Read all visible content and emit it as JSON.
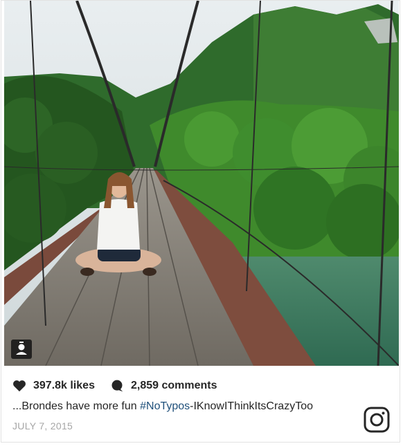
{
  "post": {
    "likes": "397.8k likes",
    "comments": "2,859 comments",
    "caption_text": "...Brondes have more fun ",
    "caption_hashtag": "#NoTypos",
    "caption_tail": "-IKnowIThinkItsCrazyToo",
    "date": "JULY 7, 2015"
  },
  "icons": {
    "like": "heart-icon",
    "comment": "comment-icon",
    "user_tag": "person-tag-icon",
    "brand": "instagram-icon"
  },
  "colors": {
    "text": "#262626",
    "hashtag": "#1e4f7a",
    "date": "#a6a6a6"
  }
}
